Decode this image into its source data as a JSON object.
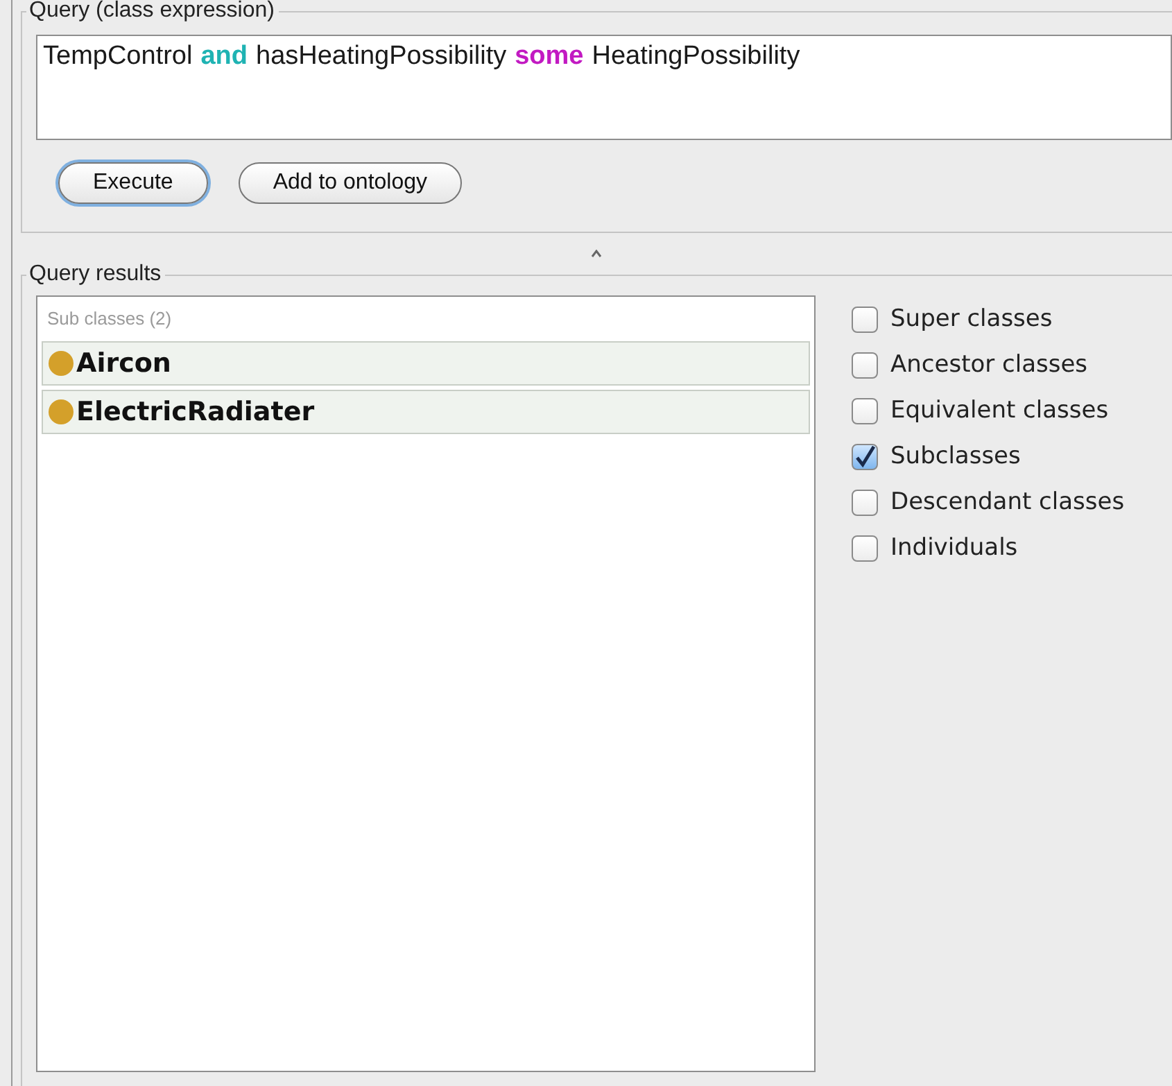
{
  "query": {
    "title": "Query (class expression)",
    "tokens": [
      {
        "text": "TempControl",
        "color": "#1a1a1a",
        "bold": false
      },
      {
        "text": "and",
        "color": "#1fb3b3",
        "bold": true
      },
      {
        "text": "hasHeatingPossibility",
        "color": "#1a1a1a",
        "bold": false
      },
      {
        "text": "some",
        "color": "#c21ac2",
        "bold": true
      },
      {
        "text": "HeatingPossibility",
        "color": "#1a1a1a",
        "bold": false
      }
    ],
    "buttons": [
      {
        "label": "Execute",
        "default": true
      },
      {
        "label": "Add to ontology",
        "default": false
      }
    ]
  },
  "results": {
    "title": "Query results",
    "section": "Sub classes (2)",
    "items": [
      {
        "label": "Aircon",
        "color": "#d4a02a"
      },
      {
        "label": "ElectricRadiater",
        "color": "#d4a02a"
      }
    ],
    "options": [
      {
        "label": "Super classes",
        "checked": false
      },
      {
        "label": "Ancestor classes",
        "checked": false
      },
      {
        "label": "Equivalent classes",
        "checked": false
      },
      {
        "label": "Subclasses",
        "checked": true
      },
      {
        "label": "Descendant classes",
        "checked": false
      },
      {
        "label": "Individuals",
        "checked": false
      }
    ]
  }
}
